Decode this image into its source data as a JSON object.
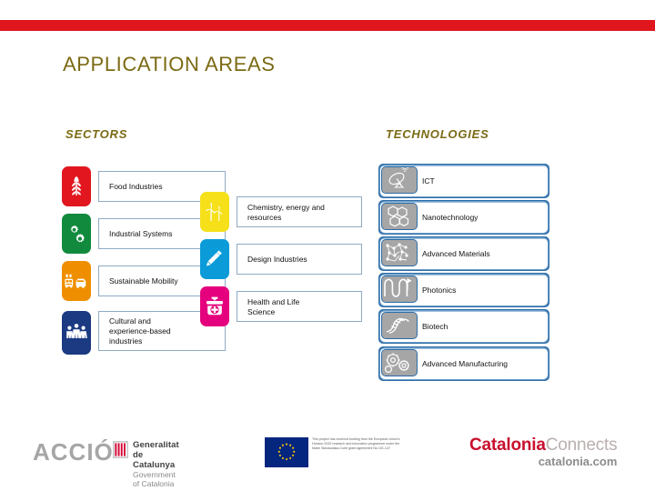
{
  "slide": {
    "title": "APPLICATION AREAS",
    "accent_red": "#e0161e",
    "title_color": "#7b6a14"
  },
  "columns": {
    "sectors_heading": "SECTORS",
    "technologies_heading": "TECHNOLOGIES"
  },
  "sectors": [
    {
      "label": "Food Industries",
      "icon": "wheat-icon",
      "color": "#e1161e"
    },
    {
      "label": "Industrial Systems",
      "icon": "gears-icon",
      "color": "#118a3d"
    },
    {
      "label": "Sustainable Mobility",
      "icon": "vehicles-icon",
      "color": "#ef8f00"
    },
    {
      "label": "Cultural and\nexperience-based\nindustries",
      "icon": "people-icon",
      "color": "#1b3a82"
    }
  ],
  "middle": [
    {
      "label": "Chemistry, energy and\nresources",
      "icon": "wind-turbine-icon",
      "color": "#f5e01a"
    },
    {
      "label": "Design Industries",
      "icon": "pen-icon",
      "color": "#0a9bd8"
    },
    {
      "label": "Health and Life\nScience",
      "icon": "medical-bag-icon",
      "color": "#e5007d"
    }
  ],
  "technologies": [
    {
      "label": "ICT",
      "icon": "satellite-dish-icon"
    },
    {
      "label": "Nanotechnology",
      "icon": "hexagon-cells-icon"
    },
    {
      "label": "Advanced Materials",
      "icon": "molecule-network-icon"
    },
    {
      "label": "Photonics",
      "icon": "waveform-icon"
    },
    {
      "label": "Biotech",
      "icon": "dna-icon"
    },
    {
      "label": "Advanced Manufacturing",
      "icon": "cogs-icon"
    }
  ],
  "footer": {
    "accio": "ACCIÓ",
    "gencat_line1": "Generalitat de Catalunya",
    "gencat_line2": "Government of Catalonia",
    "eu_disclaimer": "This project has received funding from the European Union's Horizon 2020 research and innovation programme under the Marie Skłodowska-Curie grant agreement No 101.147",
    "catalonia_bold": "Catalonia",
    "catalonia_light": "Connects",
    "catalonia_domain": "catalonia.com"
  }
}
